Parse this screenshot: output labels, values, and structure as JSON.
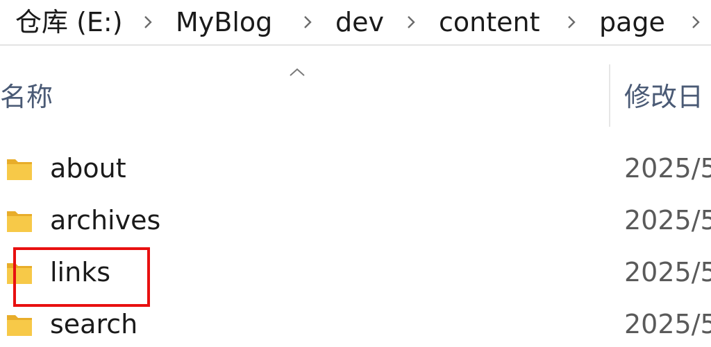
{
  "breadcrumb": {
    "items": [
      {
        "label": "仓库 (E:)"
      },
      {
        "label": "MyBlog"
      },
      {
        "label": "dev"
      },
      {
        "label": "content"
      },
      {
        "label": "page"
      }
    ]
  },
  "columns": {
    "name_label": "名称",
    "date_label": "修改日",
    "sort_icon": "chevron-up-icon"
  },
  "rows": [
    {
      "name": "about",
      "date": "2025/5",
      "icon": "folder-icon"
    },
    {
      "name": "archives",
      "date": "2025/5",
      "icon": "folder-icon"
    },
    {
      "name": "links",
      "date": "2025/5",
      "icon": "folder-icon",
      "highlighted": true
    },
    {
      "name": "search",
      "date": "2025/5",
      "icon": "folder-icon"
    }
  ],
  "colors": {
    "highlight_border": "#e81010",
    "folder_yellow": "#f7c948",
    "header_text": "#4a5a75"
  }
}
